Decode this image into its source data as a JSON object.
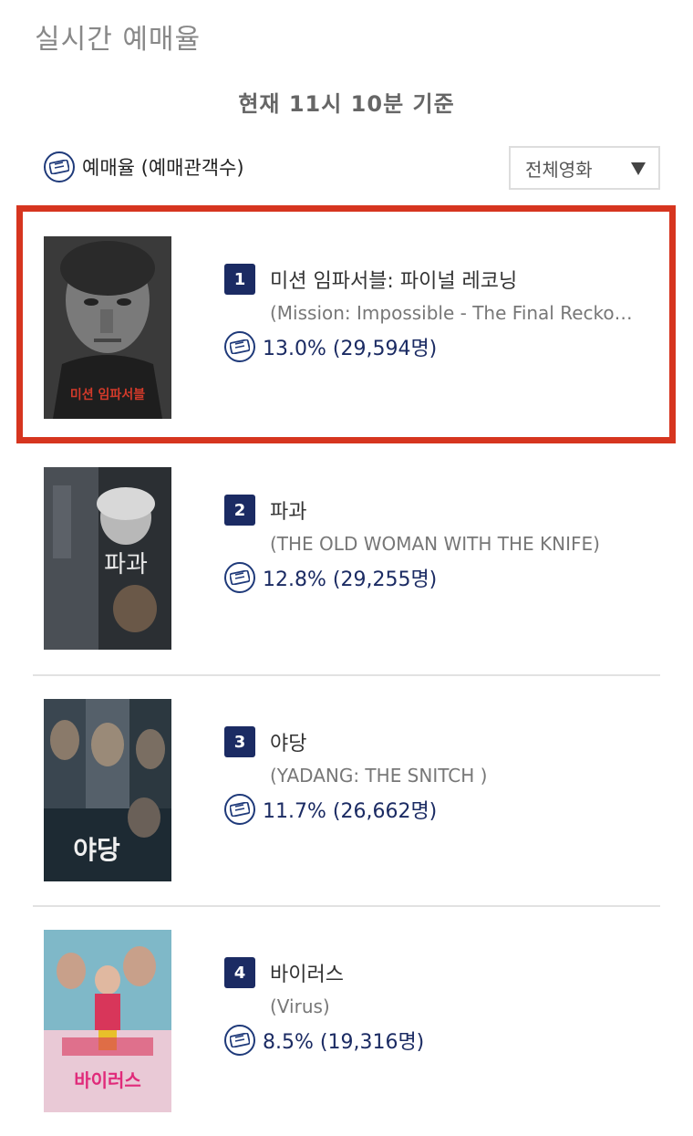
{
  "header": {
    "title": "실시간 예매율",
    "time_label": "현재  11시 10분   기준"
  },
  "legend": {
    "icon": "ticket-icon",
    "label": "예매율 (예매관객수)"
  },
  "filter": {
    "selected": "전체영화"
  },
  "colors": {
    "accent": "#1b2b63",
    "highlight": "#d6351f"
  },
  "movies": [
    {
      "rank": "1",
      "title_ko": "미션 임파서블: 파이널 레코닝",
      "title_en": "(Mission: Impossible - The Final Recko…",
      "rate": "13.0% (29,594명)",
      "poster_text": "미션 임파서블"
    },
    {
      "rank": "2",
      "title_ko": "파과",
      "title_en": "(THE OLD WOMAN WITH THE KNIFE)",
      "rate": "12.8% (29,255명)",
      "poster_text": "파과"
    },
    {
      "rank": "3",
      "title_ko": "야당",
      "title_en": "(YADANG: THE SNITCH )",
      "rate": "11.7% (26,662명)",
      "poster_text": "야당"
    },
    {
      "rank": "4",
      "title_ko": "바이러스",
      "title_en": "(Virus)",
      "rate": "8.5% (19,316명)",
      "poster_text": "바이러스"
    }
  ]
}
